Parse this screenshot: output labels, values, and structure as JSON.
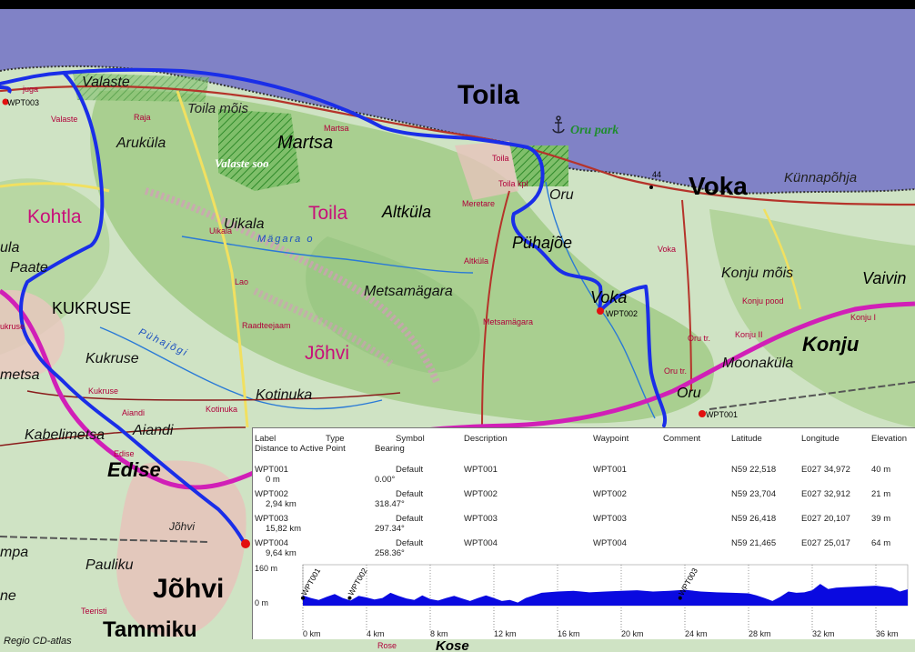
{
  "map": {
    "labels": {
      "toila": "Toila",
      "voka": "Voka",
      "oru_park": "Oru park",
      "kunnapohja": "Künnapõhja",
      "valaste": "Valaste",
      "toila_mois": "Toila mõis",
      "arukula": "Aruküla",
      "martsa": "Martsa",
      "valaste_soo": "Valaste soo",
      "kohtla": "Kohtla",
      "uikala": "Uikala",
      "toila_region": "Toila",
      "altkula": "Altküla",
      "oru": "Oru",
      "puhajoe": "Pühajõe",
      "magara_river": "Mägara o",
      "ula": "ula",
      "paate": "Paate",
      "metsamagara": "Metsamägara",
      "voka_small": "Voka",
      "konju_mois": "Konju mõis",
      "vaivina": "Vaivin",
      "kukruse_upper": "KUKRUSE",
      "johvi_region": "Jõhvi",
      "konju": "Konju",
      "kukruse": "Kukruse",
      "puhajogi_river": "Pühajõgi",
      "moonakula": "Moonaküla",
      "metsa": "metsa",
      "kotinuka": "Kotinuka",
      "oru_south": "Oru",
      "aiandi": "Aiandi",
      "kabelimetsa": "Kabelimetsa",
      "edise": "Edise",
      "johvi_small": "Jõhvi",
      "mpa": "mpa",
      "pauliku": "Pauliku",
      "johvi": "Jõhvi",
      "tammiku": "Tammiku",
      "ahtme": "ne",
      "kose": "Kose"
    },
    "small": {
      "raja": "Raja",
      "valaste": "Valaste",
      "martsa": "Martsa",
      "toila": "Toila",
      "toila_kpl": "Toila kpl",
      "meretare": "Meretare",
      "uikala": "Uikala",
      "lao": "Lao",
      "altkula": "Altküla",
      "raadteejaam": "Raadteejaam",
      "metsamagara": "Metsamägara",
      "voka": "Voka",
      "konju_pood": "Konju pood",
      "konju_i": "Konju I",
      "konju_ii": "Konju II",
      "oru_tr": "Oru tr.",
      "oru_tr2": "Oru tr.",
      "kukruse": "ukruse",
      "kukruse2": "Kukruse",
      "aiandi": "Aiandi",
      "kotinuka": "Kotinuka",
      "edise": "Edise",
      "juga": "juga",
      "teeristi": "Teeristi",
      "rose": "Rose",
      "elev44": "44"
    },
    "wpt": {
      "wpt002": "WPT002",
      "wpt001": "WPT001",
      "wpt003": "WPT003"
    },
    "credit": "Regio CD-atlas"
  },
  "panel": {
    "headers": {
      "label": "Label",
      "type": "Type",
      "symbol": "Symbol",
      "description": "Description",
      "waypoint": "Waypoint",
      "comment": "Comment",
      "latitude": "Latitude",
      "longitude": "Longitude",
      "elevation": "Elevation",
      "distance": "Distance to Active Point",
      "bearing": "Bearing"
    },
    "rows": [
      {
        "label": "WPT001",
        "distance": "0 m",
        "symbol": "Default",
        "bearing": "0.00°",
        "description": "WPT001",
        "waypoint": "WPT001",
        "latitude": "N59 22,518",
        "longitude": "E027 34,972",
        "elevation": "40 m"
      },
      {
        "label": "WPT002",
        "distance": "2,94 km",
        "symbol": "Default",
        "bearing": "318.47°",
        "description": "WPT002",
        "waypoint": "WPT002",
        "latitude": "N59 23,704",
        "longitude": "E027 32,912",
        "elevation": "21 m"
      },
      {
        "label": "WPT003",
        "distance": "15,82 km",
        "symbol": "Default",
        "bearing": "297.34°",
        "description": "WPT003",
        "waypoint": "WPT003",
        "latitude": "N59 26,418",
        "longitude": "E027 20,107",
        "elevation": "39 m"
      },
      {
        "label": "WPT004",
        "distance": "9,64 km",
        "symbol": "Default",
        "bearing": "258.36°",
        "description": "WPT004",
        "waypoint": "WPT004",
        "latitude": "N59 21,465",
        "longitude": "E027 25,017",
        "elevation": "64 m"
      }
    ],
    "profile": {
      "y_top_label": "160 m",
      "y_bottom_label": "0 m",
      "x_ticks": [
        "0 km",
        "4 km",
        "8 km",
        "12 km",
        "16 km",
        "20 km",
        "24 km",
        "28 km",
        "32 km",
        "36 km"
      ],
      "x_max_km": 38,
      "y_max_m": 160,
      "fill_color": "#0a0ae0",
      "waypoint_labels": [
        {
          "name": "WPT001",
          "km": 0
        },
        {
          "name": "WPT002",
          "km": 2.94
        },
        {
          "name": "WPT003",
          "km": 23.7
        }
      ],
      "elevation_km": [
        0,
        0.5,
        1,
        1.5,
        2,
        2.5,
        3,
        3.5,
        4,
        4.5,
        5,
        5.5,
        6,
        6.5,
        7,
        7.5,
        8,
        8.5,
        9,
        9.5,
        10,
        10.5,
        11,
        11.5,
        12,
        12.5,
        13,
        13.5,
        14,
        15,
        16,
        17,
        18,
        19,
        20,
        21,
        22,
        23,
        24,
        25,
        26,
        27,
        28,
        28.5,
        29,
        29.5,
        30,
        30.5,
        31,
        31.5,
        32,
        32.5,
        33,
        33.5,
        34,
        35,
        36,
        37,
        37.5,
        38
      ],
      "elevation_m": [
        40,
        30,
        22,
        35,
        45,
        30,
        20,
        38,
        32,
        24,
        30,
        50,
        38,
        28,
        22,
        40,
        26,
        20,
        30,
        38,
        28,
        18,
        30,
        40,
        30,
        18,
        22,
        12,
        30,
        50,
        55,
        58,
        52,
        55,
        58,
        60,
        55,
        58,
        62,
        55,
        52,
        50,
        48,
        40,
        30,
        18,
        35,
        55,
        50,
        52,
        60,
        85,
        65,
        70,
        72,
        75,
        78,
        70,
        55,
        64
      ]
    }
  }
}
